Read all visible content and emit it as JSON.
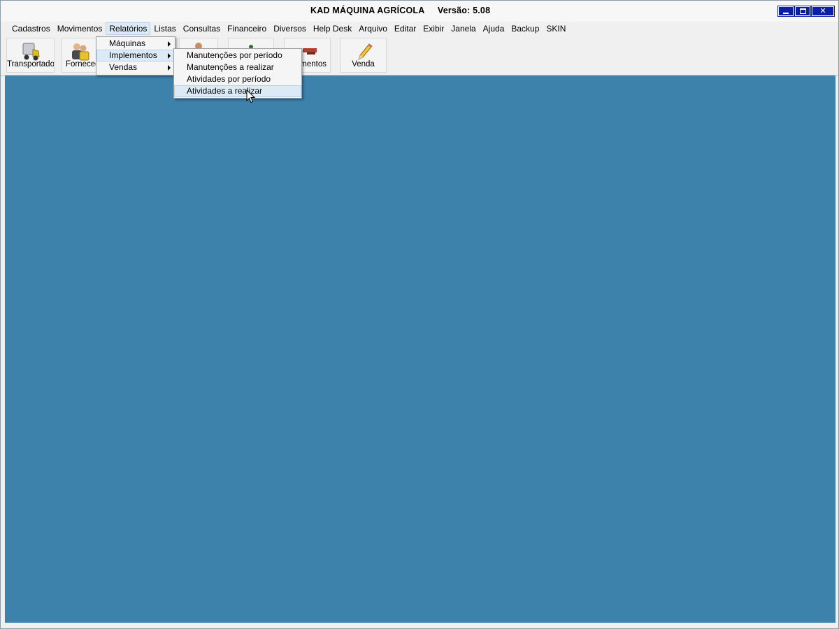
{
  "window": {
    "title": "KAD MÁQUINA AGRÍCOLA",
    "version": "Versão: 5.08"
  },
  "menubar": [
    {
      "label": "Cadastros"
    },
    {
      "label": "Movimentos"
    },
    {
      "label": "Relatórios"
    },
    {
      "label": "Listas"
    },
    {
      "label": "Consultas"
    },
    {
      "label": "Financeiro"
    },
    {
      "label": "Diversos"
    },
    {
      "label": "Help Desk"
    },
    {
      "label": "Arquivo"
    },
    {
      "label": "Editar"
    },
    {
      "label": "Exibir"
    },
    {
      "label": "Janela"
    },
    {
      "label": "Ajuda"
    },
    {
      "label": "Backup"
    },
    {
      "label": "SKIN"
    }
  ],
  "toolbar": {
    "transportador": "Transportador",
    "fornecedor": "Fornecedo",
    "implementos": "ementos",
    "venda": "Venda"
  },
  "relatorios_menu": [
    {
      "label": "Máquinas",
      "icon": "submenu-arrow-icon"
    },
    {
      "label": "Implementos",
      "icon": "submenu-arrow-icon"
    },
    {
      "label": "Vendas",
      "icon": "submenu-arrow-icon"
    }
  ],
  "implementos_submenu": [
    {
      "label": "Manutenções por período"
    },
    {
      "label": "Manutenções a realizar"
    },
    {
      "label": "Atividades por período"
    },
    {
      "label": "Atividades a realizar"
    }
  ],
  "colors": {
    "workspace": "#3c82ab",
    "titlebar_buttons": "#0a1fa6",
    "highlight": "#dce9f7"
  }
}
